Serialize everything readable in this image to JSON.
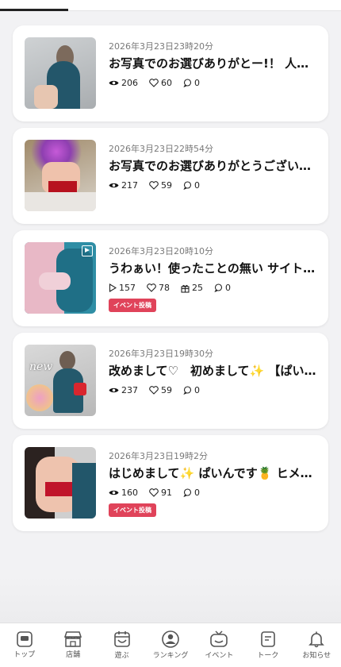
{
  "tabs_strip": {
    "active_index": 0
  },
  "posts": [
    {
      "date": "2026年3月23日23時20分",
      "title": "お写真でのお選びありがとー!！ 人…",
      "views": "206",
      "likes": "60",
      "comments": "0",
      "tag": null,
      "video": false
    },
    {
      "date": "2026年3月23日22時54分",
      "title": "お写真でのお選びありがとうござい…",
      "views": "217",
      "likes": "59",
      "comments": "0",
      "tag": null,
      "video": false
    },
    {
      "date": "2026年3月23日20時10分",
      "title": "うわぁい！使ったことの無い サイト…",
      "plays": "157",
      "likes": "78",
      "gifts": "25",
      "comments": "0",
      "tag": "イベント投稿",
      "video": true
    },
    {
      "date": "2026年3月23日19時30分",
      "title": "改めまして♡　初めまして✨ 【ぱい…",
      "views": "237",
      "likes": "59",
      "comments": "0",
      "tag": null,
      "video": false,
      "thumb_text": "new"
    },
    {
      "date": "2026年3月23日19時2分",
      "title": "はじめまして✨ ぱいんです🍍 ヒメ…",
      "views": "160",
      "likes": "91",
      "comments": "0",
      "tag": "イベント投稿",
      "video": false
    }
  ],
  "bottom_nav": [
    {
      "label": "トップ",
      "icon": "home-icon"
    },
    {
      "label": "店舗",
      "icon": "store-icon"
    },
    {
      "label": "遊ぶ",
      "icon": "calendar-icon"
    },
    {
      "label": "ランキング",
      "icon": "ranking-icon"
    },
    {
      "label": "イベント",
      "icon": "tv-icon"
    },
    {
      "label": "トーク",
      "icon": "chat-icon"
    },
    {
      "label": "お知らせ",
      "icon": "bell-icon"
    }
  ],
  "colors": {
    "tag_bg": "#e0435a",
    "background": "#f2f2f4"
  }
}
